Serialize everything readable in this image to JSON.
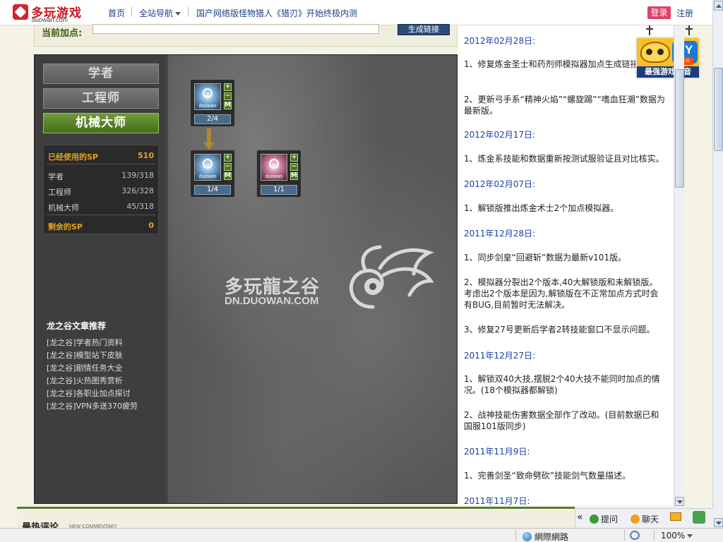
{
  "header": {
    "brand": "多玩游戏",
    "domain": "duowan.com",
    "nav_home": "首页",
    "nav_sites": "全站导航",
    "nav_news": "国产网络版怪物猎人《猎刃》开始终极内测",
    "login": "登录",
    "register": "注册"
  },
  "form": {
    "current_points_label": "当前加点:",
    "generate_link_button": "生成链接"
  },
  "classes": {
    "tabs": [
      "学者",
      "工程师",
      "机械大师"
    ],
    "active": "机械大师"
  },
  "sp": {
    "used_label": "已经使用的SP",
    "used_value": "510",
    "rows": [
      {
        "label": "学者",
        "value": "139/318"
      },
      {
        "label": "工程师",
        "value": "326/328"
      },
      {
        "label": "机械大师",
        "value": "45/318"
      }
    ],
    "remaining_label": "剩余的SP",
    "remaining_value": "0"
  },
  "articles": {
    "title": "龙之谷文章推荐",
    "items": [
      "[龙之谷]学者热门资料",
      "[龙之谷]模型站下皮肤",
      "[龙之谷]剧情任务大全",
      "[龙之谷]火热图秀赏析",
      "[龙之谷]各职业加点探讨",
      "[龙之谷]VPN多送370疲劳"
    ]
  },
  "skills": [
    {
      "icon": "duowan",
      "level": "2/4",
      "plus": "+",
      "minus": "−",
      "max": "M"
    },
    {
      "icon": "duowan",
      "level": "1/4",
      "plus": "+",
      "minus": "−",
      "max": "M"
    },
    {
      "icon": "duowan",
      "level": "1/1",
      "plus": "+",
      "minus": "−",
      "max": "M"
    }
  ],
  "watermark": {
    "title": "多玩龍之谷",
    "sub": "DN.DUOWAN.COM"
  },
  "changelog": [
    {
      "date": "2012年02月28日:",
      "entries": [
        "1、修复炼金圣士和药剂师模拟器加点生成链接问题。",
        "2、更新弓手系“精神火焰”“螺旋踢”“嗜血狂潮”数据为最新版。"
      ]
    },
    {
      "date": "2012年02月17日:",
      "entries": [
        "1、炼金系技能和数据重新按测试服验证且对比核实。"
      ]
    },
    {
      "date": "2012年02月07日:",
      "entries": [
        "1、解锁版推出炼金术士2个加点模拟器。"
      ]
    },
    {
      "date": "2011年12月28日:",
      "entries": [
        "1、同步剑皇“回避斩”数据为最新v101版。",
        "2、模拟器分裂出2个版本,40大解锁版和未解锁版。考虑出2个版本是因为,解锁版在不正常加点方式时会有BUG,目前暂时无法解决。",
        "3、修复27号更新后学者2转技能窗口不显示问题。"
      ]
    },
    {
      "date": "2011年12月27日:",
      "entries": [
        "1、解锁双40大技,摆脱2个40大技不能同时加点的情况。(18个模拟器都解锁)",
        "2、战神技能伤害数据全部作了改动。(目前数据已和国服101版同步)"
      ]
    },
    {
      "date": "2011年11月9日:",
      "entries": [
        "1、完善剑圣“致命劈砍”技能剑气数量描述。"
      ]
    },
    {
      "date": "2011年11月7日:",
      "entries": []
    }
  ],
  "yy": {
    "logo": "YY",
    "version": "4.0",
    "slogan": "最强游戏语音"
  },
  "comments": {
    "title": "最热评论",
    "sub": "NEW COMMENTARY"
  },
  "tools": {
    "ask": "提问",
    "chat": "聊天",
    "collapse": "«"
  },
  "status": {
    "zone": "網際網路",
    "zoom": "100%"
  },
  "colors": {
    "accent_green": "#466d1c",
    "link_blue": "#1a3fa8",
    "highlight_orange": "#e2a320",
    "brand_red": "#c8161d"
  }
}
